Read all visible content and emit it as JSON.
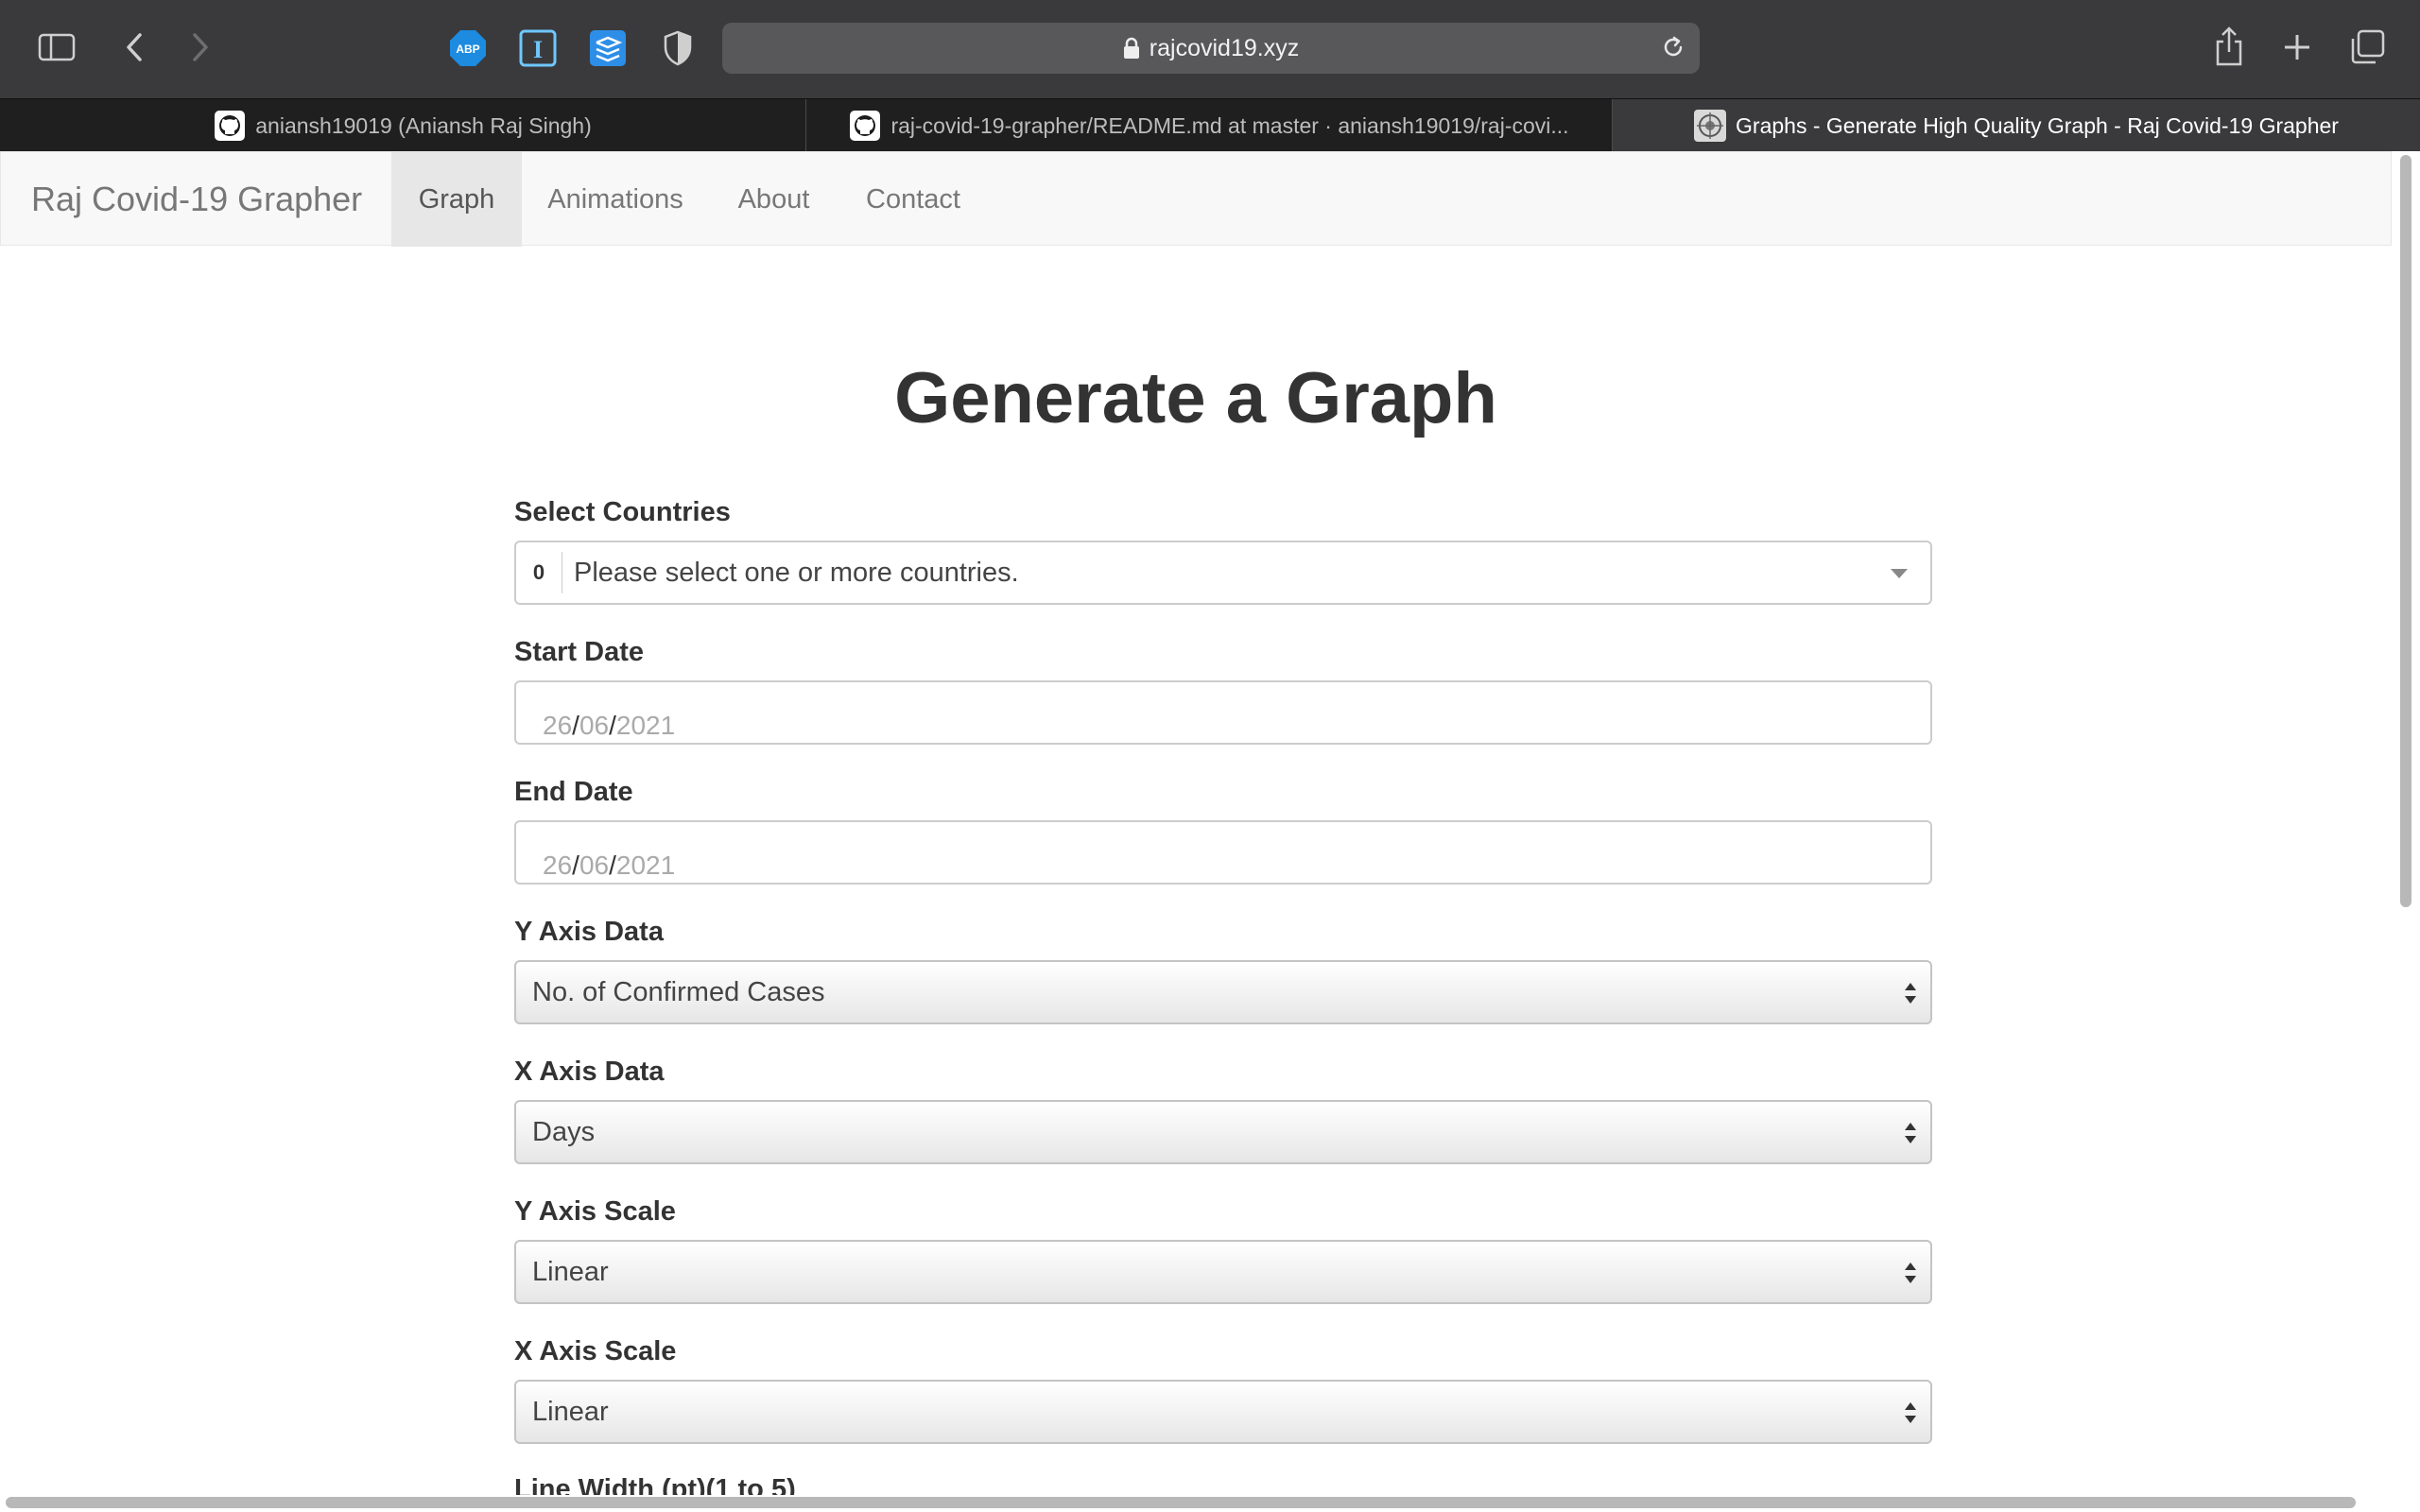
{
  "browser": {
    "url": "rajcovid19.xyz",
    "tabs": [
      {
        "label": "aniansh19019 (Aniansh Raj Singh)",
        "icon": "github-icon"
      },
      {
        "label": "raj-covid-19-grapher/README.md at master · aniansh19019/raj-covi...",
        "icon": "github-icon"
      },
      {
        "label": "Graphs - Generate High Quality Graph - Raj Covid-19 Grapher",
        "icon": "site-favicon"
      }
    ],
    "extensions": [
      "adblock-plus-icon",
      "instapaper-icon",
      "buffer-icon",
      "privacy-shield-icon"
    ],
    "abp_text": "ABP",
    "instapaper_text": "I"
  },
  "navbar": {
    "brand": "Raj Covid-19 Grapher",
    "items": [
      "Graph",
      "Animations",
      "About",
      "Contact"
    ],
    "active": "Graph"
  },
  "page": {
    "title": "Generate a Graph"
  },
  "form": {
    "countries": {
      "label": "Select Countries",
      "count": "0",
      "placeholder": "Please select one or more countries."
    },
    "start_date": {
      "label": "Start Date",
      "day": "26",
      "month": "06",
      "year": "2021",
      "sep": "/"
    },
    "end_date": {
      "label": "End Date",
      "day": "26",
      "month": "06",
      "year": "2021",
      "sep": "/"
    },
    "y_axis_data": {
      "label": "Y Axis Data",
      "value": "No. of Confirmed Cases"
    },
    "x_axis_data": {
      "label": "X Axis Data",
      "value": "Days"
    },
    "y_axis_scale": {
      "label": "Y Axis Scale",
      "value": "Linear"
    },
    "x_axis_scale": {
      "label": "X Axis Scale",
      "value": "Linear"
    },
    "next_label_partial": "Line Width (pt)(1 to 5)"
  },
  "colors": {
    "chrome": "#3a3a3c",
    "tabbar": "#1f1f20",
    "navbar_bg": "#f8f8f8",
    "text": "#333333"
  }
}
